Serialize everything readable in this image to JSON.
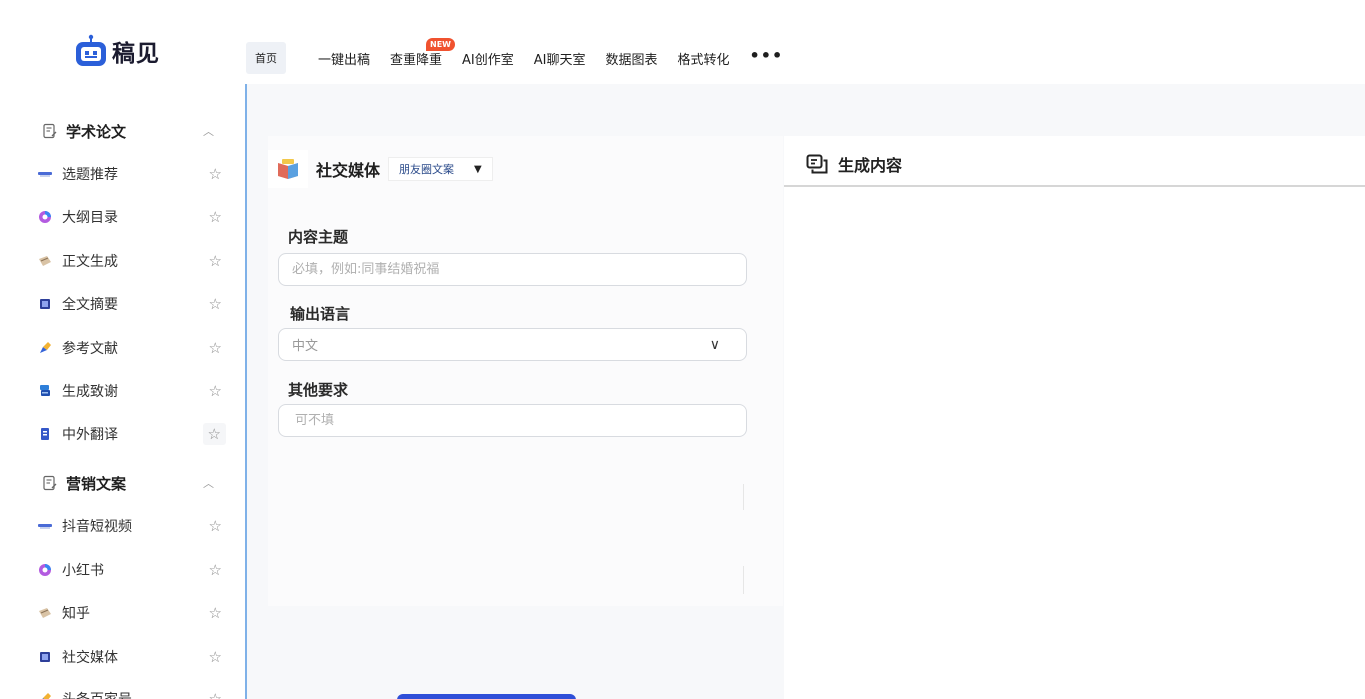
{
  "brand": {
    "name": "稿见"
  },
  "nav": {
    "home": "首页",
    "items": [
      "一键出稿",
      "查重降重",
      "AI创作室",
      "AI聊天室",
      "数据图表",
      "格式转化"
    ],
    "new_badge": "NEW",
    "more": "•••"
  },
  "sidebar": {
    "sections": [
      {
        "title": "学术论文",
        "items": [
          "选题推荐",
          "大纲目录",
          "正文生成",
          "全文摘要",
          "参考文献",
          "生成致谢",
          "中外翻译"
        ]
      },
      {
        "title": "营销文案",
        "items": [
          "抖音短视频",
          "小红书",
          "知乎",
          "社交媒体",
          "头条百家号"
        ]
      }
    ]
  },
  "form": {
    "title": "社交媒体",
    "selected_type": "朋友圈文案",
    "topic_label": "内容主题",
    "topic_placeholder": "必填，例如:同事结婚祝福",
    "lang_label": "输出语言",
    "lang_value": "中文",
    "other_label": "其他要求",
    "other_placeholder": "可不填"
  },
  "output": {
    "title": "生成内容"
  },
  "colors": {
    "accent": "#2f4fd8",
    "sidebar_border": "#7fb1e8",
    "badge": "#f0522f"
  }
}
